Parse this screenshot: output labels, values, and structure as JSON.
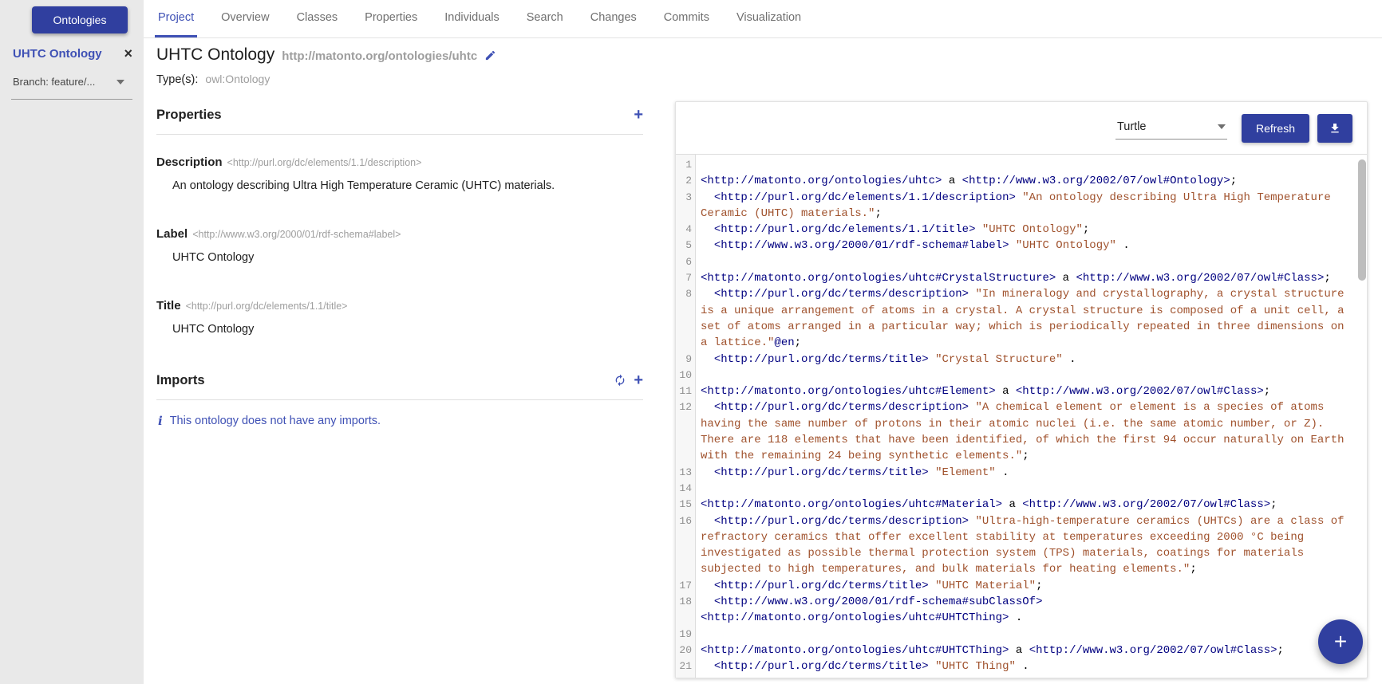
{
  "colors": {
    "primary": "#303f9f",
    "accent": "#3f51b5",
    "code_iri": "#000080",
    "code_string": "#a0522d",
    "code_plain": "#000000",
    "sidebar_bg": "#e9e9e9"
  },
  "icons": {
    "plus": "+",
    "close": "×",
    "info": "i"
  },
  "sidebar": {
    "ontologies_button": "Ontologies",
    "ontology_name": "UHTC Ontology",
    "branch_label": "Branch: feature/..."
  },
  "tabs": {
    "active": "Project",
    "items": [
      "Project",
      "Overview",
      "Classes",
      "Properties",
      "Individuals",
      "Search",
      "Changes",
      "Commits",
      "Visualization"
    ]
  },
  "header": {
    "title": "UHTC Ontology",
    "iri": "http://matonto.org/ontologies/uhtc",
    "types_label": "Type(s):",
    "types_value": "owl:Ontology"
  },
  "properties_section": {
    "heading": "Properties",
    "items": [
      {
        "label": "Description",
        "iri": "<http://purl.org/dc/elements/1.1/description>",
        "value": "An ontology describing Ultra High Temperature Ceramic (UHTC) materials."
      },
      {
        "label": "Label",
        "iri": "<http://www.w3.org/2000/01/rdf-schema#label>",
        "value": "UHTC Ontology"
      },
      {
        "label": "Title",
        "iri": "<http://purl.org/dc/elements/1.1/title>",
        "value": "UHTC Ontology"
      }
    ]
  },
  "imports_section": {
    "heading": "Imports",
    "empty_message": "This ontology does not have any imports."
  },
  "preview": {
    "format_selected": "Turtle",
    "refresh_label": "Refresh",
    "lines": [
      [],
      [
        [
          "i",
          "<http://matonto.org/ontologies/uhtc>"
        ],
        [
          "p",
          " a "
        ],
        [
          "i",
          "<http://www.w3.org/2002/07/owl#Ontology>"
        ],
        [
          "p",
          ";"
        ]
      ],
      [
        [
          "p",
          "  "
        ],
        [
          "i",
          "<http://purl.org/dc/elements/1.1/description>"
        ],
        [
          "p",
          " "
        ],
        [
          "s",
          "\"An ontology describing Ultra High Temperature Ceramic (UHTC) materials.\""
        ],
        [
          "p",
          ";"
        ]
      ],
      [
        [
          "p",
          "  "
        ],
        [
          "i",
          "<http://purl.org/dc/elements/1.1/title>"
        ],
        [
          "p",
          " "
        ],
        [
          "s",
          "\"UHTC Ontology\""
        ],
        [
          "p",
          ";"
        ]
      ],
      [
        [
          "p",
          "  "
        ],
        [
          "i",
          "<http://www.w3.org/2000/01/rdf-schema#label>"
        ],
        [
          "p",
          " "
        ],
        [
          "s",
          "\"UHTC Ontology\""
        ],
        [
          "p",
          " ."
        ]
      ],
      [],
      [
        [
          "i",
          "<http://matonto.org/ontologies/uhtc#CrystalStructure>"
        ],
        [
          "p",
          " a "
        ],
        [
          "i",
          "<http://www.w3.org/2002/07/owl#Class>"
        ],
        [
          "p",
          ";"
        ]
      ],
      [
        [
          "p",
          "  "
        ],
        [
          "i",
          "<http://purl.org/dc/terms/description>"
        ],
        [
          "p",
          " "
        ],
        [
          "s",
          "\"In mineralogy and crystallography, a crystal structure is a unique arrangement of atoms in a crystal. A crystal structure is composed of a unit cell, a set of atoms arranged in a particular way; which is periodically repeated in three dimensions on a lattice.\""
        ],
        [
          "m",
          "@en"
        ],
        [
          "p",
          ";"
        ]
      ],
      [
        [
          "p",
          "  "
        ],
        [
          "i",
          "<http://purl.org/dc/terms/title>"
        ],
        [
          "p",
          " "
        ],
        [
          "s",
          "\"Crystal Structure\""
        ],
        [
          "p",
          " ."
        ]
      ],
      [],
      [
        [
          "i",
          "<http://matonto.org/ontologies/uhtc#Element>"
        ],
        [
          "p",
          " a "
        ],
        [
          "i",
          "<http://www.w3.org/2002/07/owl#Class>"
        ],
        [
          "p",
          ";"
        ]
      ],
      [
        [
          "p",
          "  "
        ],
        [
          "i",
          "<http://purl.org/dc/terms/description>"
        ],
        [
          "p",
          " "
        ],
        [
          "s",
          "\"A chemical element or element is a species of atoms having the same number of protons in their atomic nuclei (i.e. the same atomic number, or Z). There are 118 elements that have been identified, of which the first 94 occur naturally on Earth with the remaining 24 being synthetic elements.\""
        ],
        [
          "p",
          ";"
        ]
      ],
      [
        [
          "p",
          "  "
        ],
        [
          "i",
          "<http://purl.org/dc/terms/title>"
        ],
        [
          "p",
          " "
        ],
        [
          "s",
          "\"Element\""
        ],
        [
          "p",
          " ."
        ]
      ],
      [],
      [
        [
          "i",
          "<http://matonto.org/ontologies/uhtc#Material>"
        ],
        [
          "p",
          " a "
        ],
        [
          "i",
          "<http://www.w3.org/2002/07/owl#Class>"
        ],
        [
          "p",
          ";"
        ]
      ],
      [
        [
          "p",
          "  "
        ],
        [
          "i",
          "<http://purl.org/dc/terms/description>"
        ],
        [
          "p",
          " "
        ],
        [
          "s",
          "\"Ultra-high-temperature ceramics (UHTCs) are a class of refractory ceramics that offer excellent stability at temperatures exceeding 2000 °C being investigated as possible thermal protection system (TPS) materials, coatings for materials subjected to high temperatures, and bulk materials for heating elements.\""
        ],
        [
          "p",
          ";"
        ]
      ],
      [
        [
          "p",
          "  "
        ],
        [
          "i",
          "<http://purl.org/dc/terms/title>"
        ],
        [
          "p",
          " "
        ],
        [
          "s",
          "\"UHTC Material\""
        ],
        [
          "p",
          ";"
        ]
      ],
      [
        [
          "p",
          "  "
        ],
        [
          "i",
          "<http://www.w3.org/2000/01/rdf-schema#subClassOf>"
        ],
        [
          "p",
          " "
        ],
        [
          "i",
          "<http://matonto.org/ontologies/uhtc#UHTCThing>"
        ],
        [
          "p",
          " ."
        ]
      ],
      [],
      [
        [
          "i",
          "<http://matonto.org/ontologies/uhtc#UHTCThing>"
        ],
        [
          "p",
          " a "
        ],
        [
          "i",
          "<http://www.w3.org/2002/07/owl#Class>"
        ],
        [
          "p",
          ";"
        ]
      ],
      [
        [
          "p",
          "  "
        ],
        [
          "i",
          "<http://purl.org/dc/terms/title>"
        ],
        [
          "p",
          " "
        ],
        [
          "s",
          "\"UHTC Thing\""
        ],
        [
          "p",
          " ."
        ]
      ]
    ]
  }
}
